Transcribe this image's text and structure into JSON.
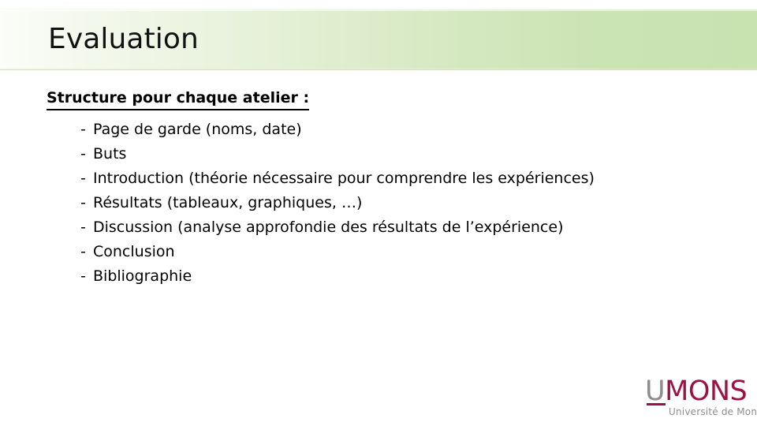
{
  "slide": {
    "title": "Evaluation",
    "background_color": "#ffffff",
    "title_band": {
      "gradient_from": "#fbfdf8",
      "gradient_to": "#c8e2b0"
    }
  },
  "body": {
    "heading": "Structure pour chaque atelier :",
    "bullet_marker": "-",
    "items": [
      {
        "text": "Page de garde (noms, date)"
      },
      {
        "text": "Buts"
      },
      {
        "text": "Introduction (théorie nécessaire pour comprendre les expériences)"
      },
      {
        "text": "Résultats (tableaux, graphiques, …)"
      },
      {
        "text": "Discussion (analyse approfondie des résultats de l’expérience)"
      },
      {
        "text": "Conclusion"
      },
      {
        "text": "Bibliographie"
      }
    ]
  },
  "logo": {
    "mark_u": "U",
    "mark_mons": "MONS",
    "subtitle": "Université de Mons",
    "accent_color": "#9d1244",
    "neutral_color": "#8d8d8d"
  }
}
